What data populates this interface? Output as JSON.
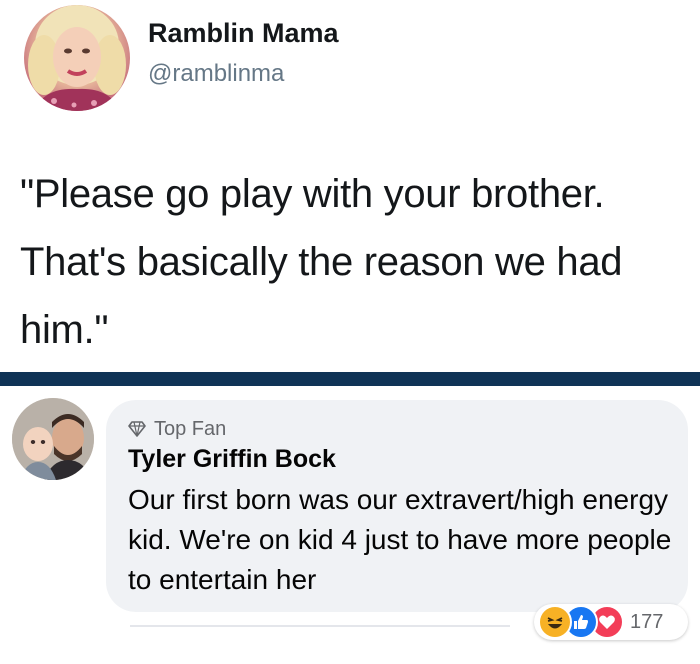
{
  "tweet": {
    "display_name": "Ramblin Mama",
    "handle": "@ramblinma",
    "text": "\"Please go play with your brother. That's basically the reason we had him.\""
  },
  "comment": {
    "badge_label": "Top Fan",
    "author": "Tyler Griffin Bock",
    "text": "Our first born was our extravert/high energy kid. We're on kid 4 just to have more people to entertain her",
    "reaction_count": "177",
    "reaction_icons": [
      "haha-icon",
      "like-icon",
      "love-icon"
    ]
  },
  "colors": {
    "divider": "#0f3356",
    "bubble": "#f0f2f5",
    "like": "#1877f2",
    "love": "#f33e58",
    "haha": "#f7b125"
  }
}
